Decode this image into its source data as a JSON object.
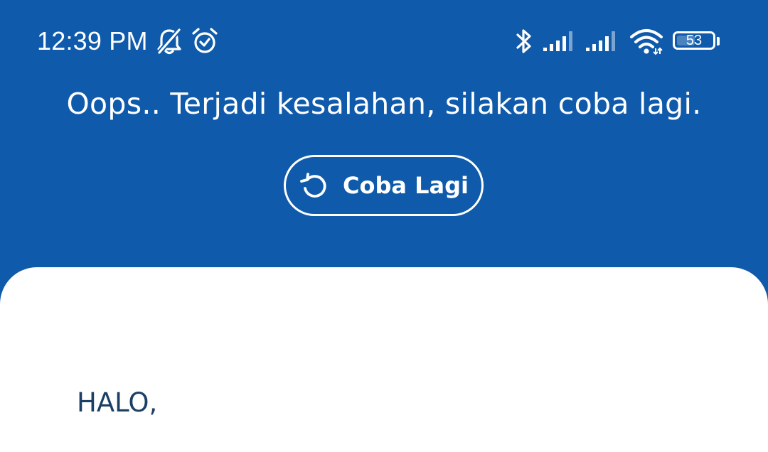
{
  "status_bar": {
    "time": "12:39 PM",
    "left_icons": [
      "bell-off-icon",
      "alarm-clock-icon"
    ],
    "right_icons": [
      "bluetooth-icon",
      "signal-sim1-icon",
      "signal-sim2-icon",
      "wifi-icon",
      "battery-icon"
    ],
    "battery_level": "53",
    "battery_fraction": 0.53
  },
  "error_banner": {
    "message": "Oops.. Terjadi kesalahan, silakan coba lagi.",
    "retry_label": "Coba Lagi",
    "retry_icon": "refresh-icon"
  },
  "content": {
    "greeting": "HALO,"
  },
  "colors": {
    "primary": "#0f5aaa",
    "text_on_primary": "#ffffff",
    "card_background": "#ffffff",
    "greeting_text": "#1c3f66"
  }
}
